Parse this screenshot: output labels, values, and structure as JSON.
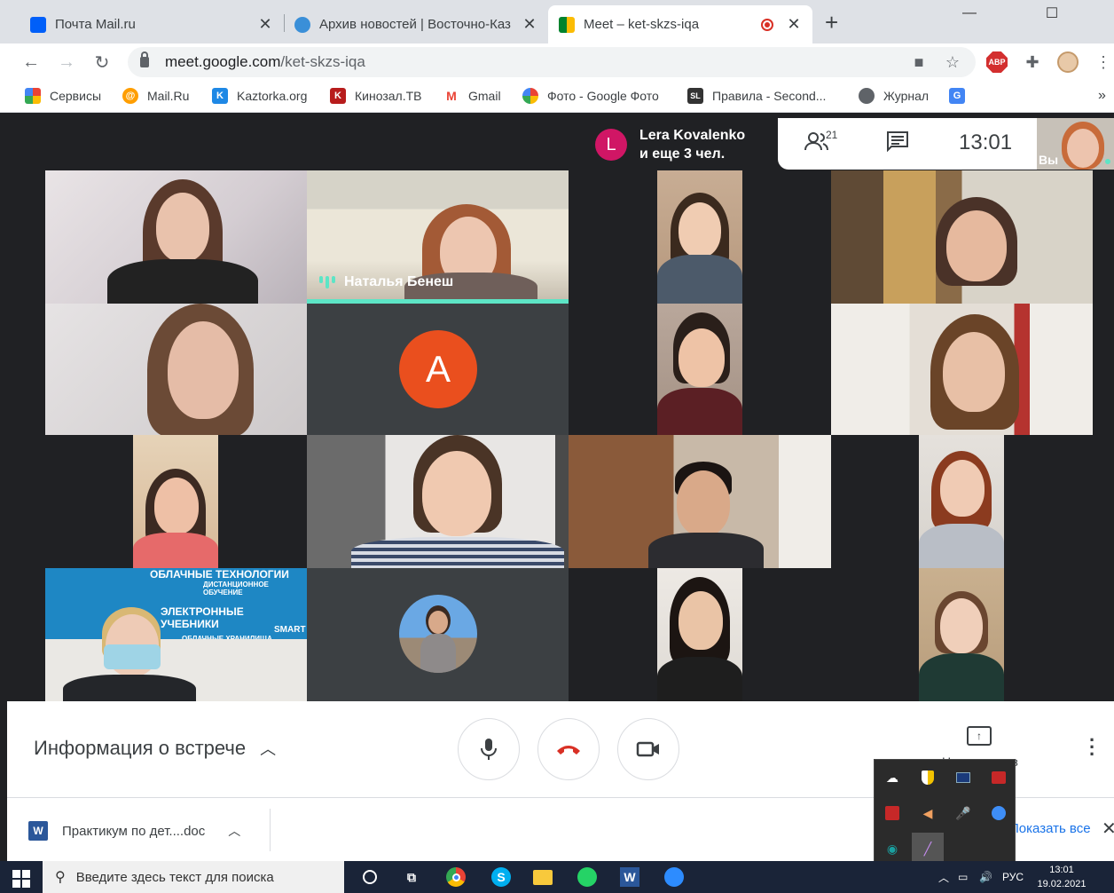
{
  "browser": {
    "tabs": [
      {
        "title": "Почта Mail.ru",
        "icon": "mail-icon",
        "color": "#005ff9"
      },
      {
        "title": "Архив новостей | Восточно-Каз",
        "icon": "news-icon",
        "color": "#3a8fd8"
      },
      {
        "title": "Meet – ket-skzs-iqa",
        "icon": "meet-icon",
        "color": "#00832d",
        "active": true
      }
    ],
    "new_tab": "+",
    "window_controls": {
      "minimize": "—",
      "maximize": "☐",
      "close": "✕"
    },
    "url_host": "meet.google.com",
    "url_path": "/ket-skzs-iqa",
    "bookmarks": [
      {
        "label": "Сервисы",
        "icon": "apps-icon"
      },
      {
        "label": "Mail.Ru",
        "icon": "at-icon",
        "color": "#ff9e00"
      },
      {
        "label": "Kaztorka.org",
        "icon": "k-icon",
        "color": "#1e88e5"
      },
      {
        "label": "Кинозал.ТВ",
        "icon": "k-icon",
        "color": "#b71c1c"
      },
      {
        "label": "Gmail",
        "icon": "gmail-icon",
        "color": "#ea4335"
      },
      {
        "label": "Фото - Google Фото",
        "icon": "photos-icon",
        "color": "#fbbc04"
      },
      {
        "label": "Правила - Second...",
        "icon": "sl-icon",
        "color": "#333333"
      },
      {
        "label": "Журнал",
        "icon": "globe-icon",
        "color": "#5f6368"
      }
    ],
    "bookmarks_overflow": "»"
  },
  "meet": {
    "top_info": {
      "avatar_letter": "L",
      "line1": "Lera Kovalenko",
      "line2": "и еще 3 чел."
    },
    "participants_count": "21",
    "time": "13:01",
    "self_label": "Вы",
    "speaker_name": "Наталья Бенеш",
    "avatar_letter": "A",
    "meeting_info": "Информация о встрече",
    "present_label": "Начать показ",
    "colors": {
      "speaking": "#5de5c6",
      "avatar_a": "#ea4f1e",
      "hangup": "#d93025"
    }
  },
  "downloads": {
    "file": "Практикум по дет....doc",
    "show_all": "Показать все"
  },
  "taskbar": {
    "search_placeholder": "Введите здесь текст для поиска",
    "lang": "РУС",
    "time": "13:01",
    "date": "19.02.2021"
  }
}
